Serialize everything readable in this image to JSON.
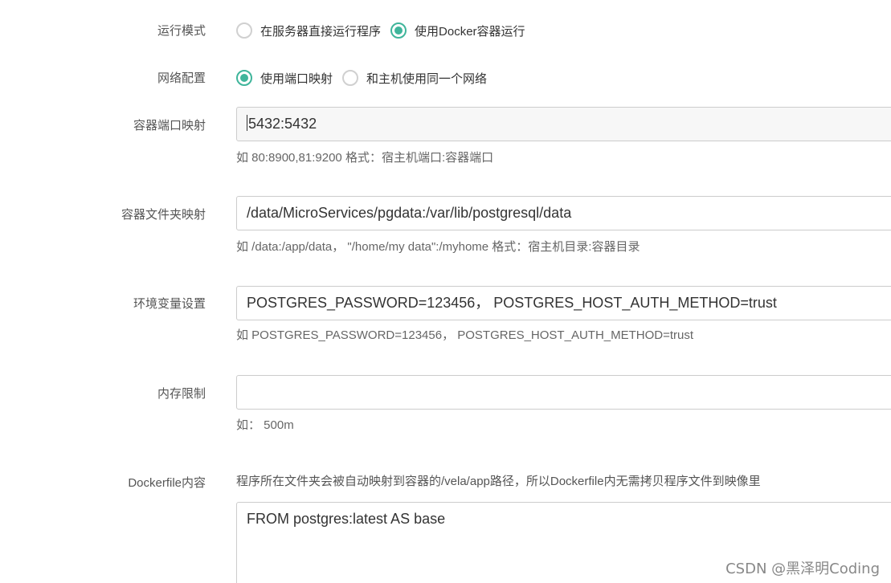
{
  "run_mode": {
    "label": "运行模式",
    "options": [
      {
        "text": "在服务器直接运行程序",
        "checked": false
      },
      {
        "text": "使用Docker容器运行",
        "checked": true
      }
    ]
  },
  "network": {
    "label": "网络配置",
    "options": [
      {
        "text": "使用端口映射",
        "checked": true
      },
      {
        "text": "和主机使用同一个网络",
        "checked": false
      }
    ]
  },
  "port_mapping": {
    "label": "容器端口映射",
    "value": "5432:5432",
    "hint": "如 80:8900,81:9200 格式：宿主机端口:容器端口"
  },
  "folder_mapping": {
    "label": "容器文件夹映射",
    "value": "/data/MicroServices/pgdata:/var/lib/postgresql/data",
    "hint": "如 /data:/app/data， \"/home/my data\":/myhome 格式：宿主机目录:容器目录"
  },
  "env_vars": {
    "label": "环境变量设置",
    "value": "POSTGRES_PASSWORD=123456， POSTGRES_HOST_AUTH_METHOD=trust",
    "hint": "如 POSTGRES_PASSWORD=123456， POSTGRES_HOST_AUTH_METHOD=trust"
  },
  "memory_limit": {
    "label": "内存限制",
    "value": "",
    "hint": "如：  500m"
  },
  "dockerfile": {
    "label": "Dockerfile内容",
    "description": "程序所在文件夹会被自动映射到容器的/vela/app路径，所以Dockerfile内无需拷贝程序文件到映像里",
    "content": "FROM postgres:latest AS base"
  },
  "watermark": "CSDN @黑泽明Coding",
  "colors": {
    "accent": "#3fb59b"
  }
}
